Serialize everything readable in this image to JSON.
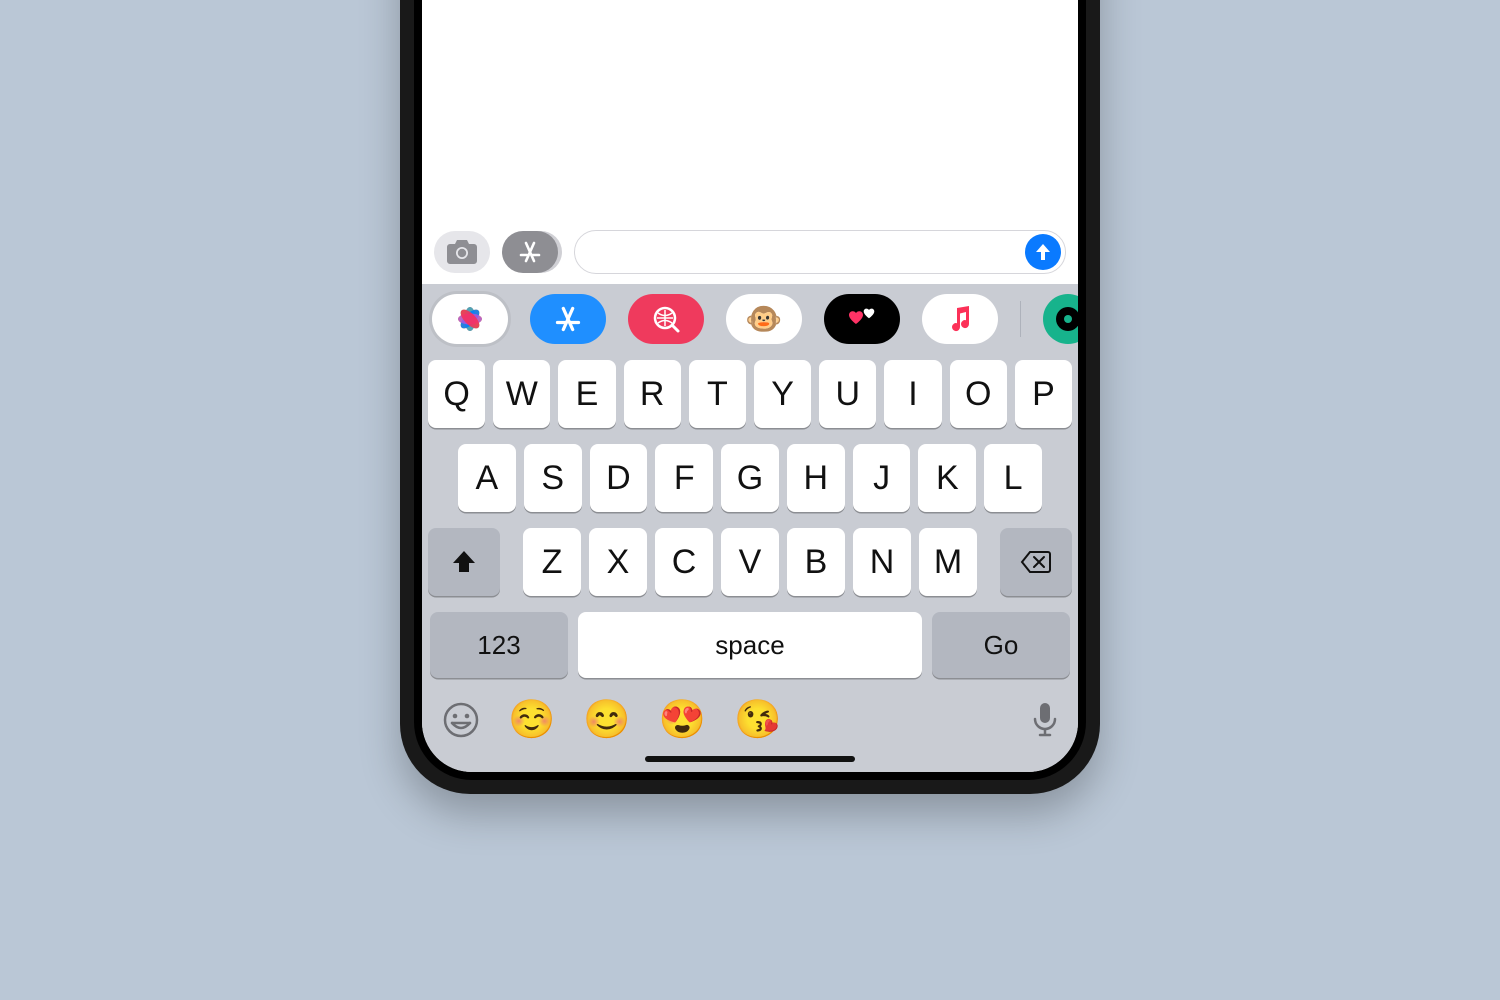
{
  "input_bar": {
    "camera_icon": "camera-icon",
    "appstore_icon": "appstore-icon",
    "message_value": "",
    "send_icon": "arrow-up-icon"
  },
  "app_strip": [
    {
      "id": "photos",
      "label": "Photos",
      "selected": true,
      "bg": "#ffffff",
      "fg": "#000",
      "glyph": "photos"
    },
    {
      "id": "store",
      "label": "App Store",
      "selected": false,
      "bg": "#1f8fff",
      "fg": "#fff",
      "glyph": "appstore"
    },
    {
      "id": "images",
      "label": "#images",
      "selected": false,
      "bg": "#ef3a5d",
      "fg": "#fff",
      "glyph": "search-grid"
    },
    {
      "id": "memoji",
      "label": "Memoji",
      "selected": false,
      "bg": "#ffffff",
      "fg": "#000",
      "glyph": "🐵"
    },
    {
      "id": "digital",
      "label": "Digital Touch",
      "selected": false,
      "bg": "#000000",
      "fg": "#fff",
      "glyph": "hearts"
    },
    {
      "id": "music",
      "label": "Music",
      "selected": false,
      "bg": "#ffffff",
      "fg": "#000",
      "glyph": "music"
    },
    {
      "id": "divider",
      "label": "divider"
    },
    {
      "id": "more",
      "label": "More",
      "selected": false,
      "bg": "#17b38c",
      "fg": "#fff",
      "glyph": "disc"
    }
  ],
  "keyboard": {
    "row1": [
      "Q",
      "W",
      "E",
      "R",
      "T",
      "Y",
      "U",
      "I",
      "O",
      "P"
    ],
    "row2": [
      "A",
      "S",
      "D",
      "F",
      "G",
      "H",
      "J",
      "K",
      "L"
    ],
    "row3": [
      "Z",
      "X",
      "C",
      "V",
      "B",
      "N",
      "M"
    ],
    "shift": "shift",
    "backspace": "backspace",
    "numbers_label": "123",
    "space_label": "space",
    "return_label": "Go"
  },
  "bottom_bar": {
    "emoji_switch": "emoji-icon",
    "emojis": [
      "☺️",
      "😊",
      "😍",
      "😘"
    ],
    "dictation": "mic-icon"
  }
}
